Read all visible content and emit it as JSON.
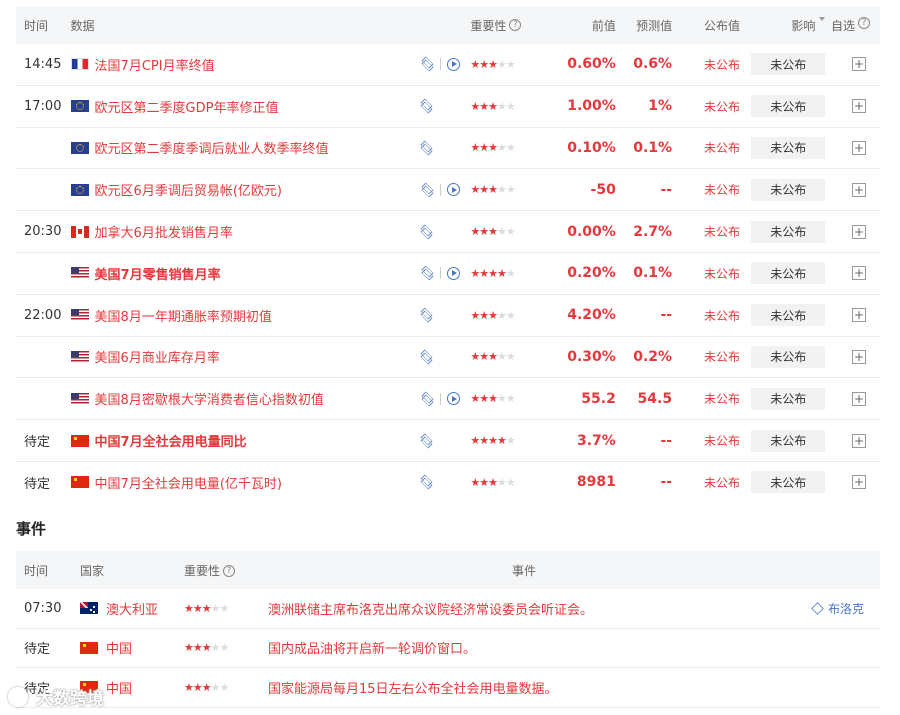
{
  "calendar": {
    "headers": {
      "time": "时间",
      "data": "数据",
      "importance": "重要性",
      "previous": "前值",
      "forecast": "预测值",
      "published": "公布值",
      "impact": "影响",
      "favorite": "自选"
    },
    "rows": [
      {
        "time": "14:45",
        "flag": "fr",
        "name": "法国7月CPI月率终值",
        "bold": false,
        "video": true,
        "stars": 3,
        "prev": "0.60%",
        "forecast": "0.6%",
        "published": "未公布",
        "impact": "未公布"
      },
      {
        "time": "17:00",
        "flag": "eu",
        "name": "欧元区第二季度GDP年率修正值",
        "bold": false,
        "video": false,
        "stars": 3,
        "prev": "1.00%",
        "forecast": "1%",
        "published": "未公布",
        "impact": "未公布"
      },
      {
        "time": "",
        "flag": "eu",
        "name": "欧元区第二季度季调后就业人数季率终值",
        "bold": false,
        "video": false,
        "stars": 3,
        "prev": "0.10%",
        "forecast": "0.1%",
        "published": "未公布",
        "impact": "未公布"
      },
      {
        "time": "",
        "flag": "eu",
        "name": "欧元区6月季调后贸易帐(亿欧元)",
        "bold": false,
        "video": true,
        "stars": 3,
        "prev": "-50",
        "forecast": "--",
        "published": "未公布",
        "impact": "未公布"
      },
      {
        "time": "20:30",
        "flag": "ca",
        "name": "加拿大6月批发销售月率",
        "bold": false,
        "video": false,
        "stars": 3,
        "prev": "0.00%",
        "forecast": "2.7%",
        "published": "未公布",
        "impact": "未公布"
      },
      {
        "time": "",
        "flag": "us",
        "name": "美国7月零售销售月率",
        "bold": true,
        "video": true,
        "stars": 4,
        "prev": "0.20%",
        "forecast": "0.1%",
        "published": "未公布",
        "impact": "未公布"
      },
      {
        "time": "22:00",
        "flag": "us",
        "name": "美国8月一年期通胀率预期初值",
        "bold": false,
        "video": false,
        "stars": 3,
        "prev": "4.20%",
        "forecast": "--",
        "published": "未公布",
        "impact": "未公布"
      },
      {
        "time": "",
        "flag": "us",
        "name": "美国6月商业库存月率",
        "bold": false,
        "video": false,
        "stars": 3,
        "prev": "0.30%",
        "forecast": "0.2%",
        "published": "未公布",
        "impact": "未公布"
      },
      {
        "time": "",
        "flag": "us",
        "name": "美国8月密歇根大学消费者信心指数初值",
        "bold": false,
        "video": true,
        "stars": 3,
        "prev": "55.2",
        "forecast": "54.5",
        "published": "未公布",
        "impact": "未公布"
      },
      {
        "time": "待定",
        "flag": "cn",
        "name": "中国7月全社会用电量同比",
        "bold": true,
        "video": false,
        "stars": 4,
        "prev": "3.7%",
        "forecast": "--",
        "published": "未公布",
        "impact": "未公布"
      },
      {
        "time": "待定",
        "flag": "cn",
        "name": "中国7月全社会用电量(亿千瓦时)",
        "bold": false,
        "video": false,
        "stars": 3,
        "prev": "8981",
        "forecast": "--",
        "published": "未公布",
        "impact": "未公布"
      }
    ]
  },
  "events": {
    "section_title": "事件",
    "headers": {
      "time": "时间",
      "country": "国家",
      "importance": "重要性",
      "event": "事件"
    },
    "rows": [
      {
        "time": "07:30",
        "flag": "au",
        "country": "澳大利亚",
        "stars": 3,
        "event": "澳洲联储主席布洛克出席众议院经济常设委员会听证会。",
        "extra": "布洛克"
      },
      {
        "time": "待定",
        "flag": "cn",
        "country": "中国",
        "stars": 3,
        "event": "国内成品油将开启新一轮调价窗口。",
        "extra": ""
      },
      {
        "time": "待定",
        "flag": "cn",
        "country": "中国",
        "stars": 3,
        "event": "国家能源局每月15日左右公布全社会用电量数据。",
        "extra": ""
      }
    ]
  },
  "watermark": "大数跨境",
  "colors": {
    "accent": "#e4393c",
    "link": "#4a78c2",
    "header_bg": "#f5f6f7"
  }
}
